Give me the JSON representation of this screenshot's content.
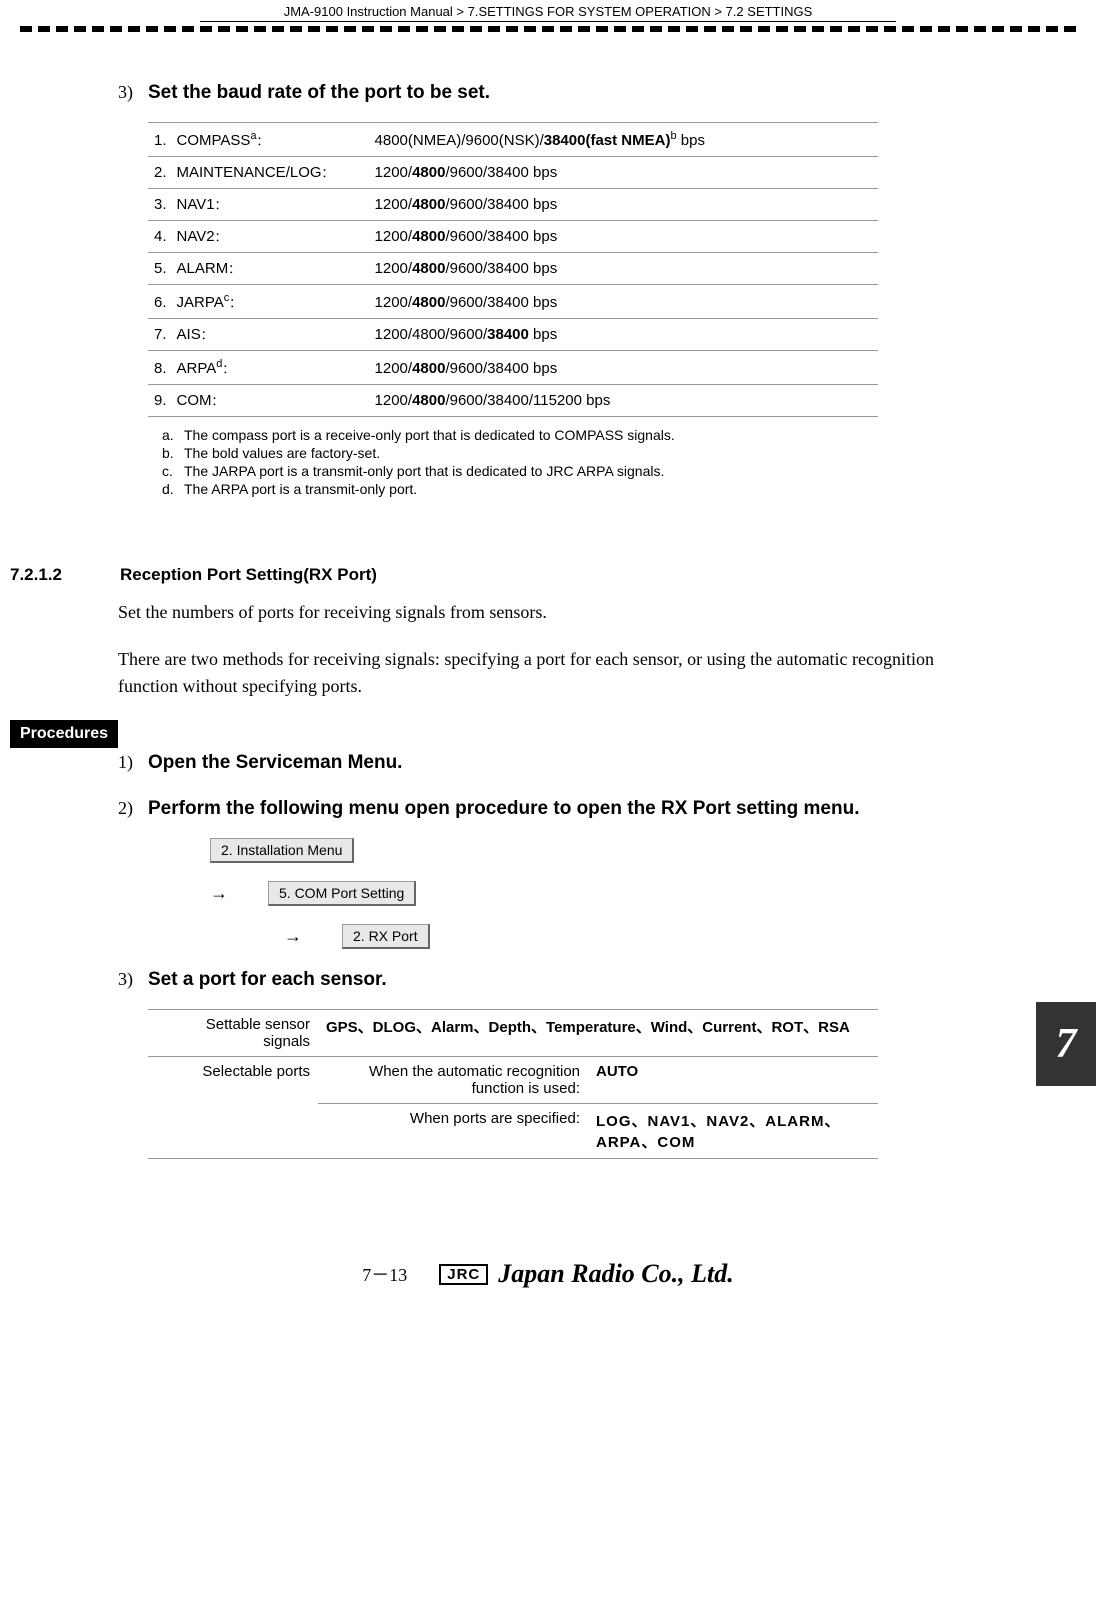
{
  "header": {
    "breadcrumb": "JMA-9100 Instruction Manual > 7.SETTINGS FOR SYSTEM OPERATION > 7.2  SETTINGS"
  },
  "step3": {
    "num": "3)",
    "text": "Set the baud rate of the port to be set."
  },
  "baud_rows": [
    {
      "n": "1.",
      "label": "COMPASS",
      "sup": "a",
      "colon": "：",
      "v_pre": "4800(NMEA)/9600(NSK)/",
      "v_bold": "38400(fast NMEA)",
      "v_sup": "b",
      "v_post": " bps"
    },
    {
      "n": "2.",
      "label": "MAINTENANCE/LOG",
      "sup": "",
      "colon": "：",
      "v_pre": "1200/",
      "v_bold": "4800",
      "v_sup": "",
      "v_post": "/9600/38400 bps"
    },
    {
      "n": "3.",
      "label": "NAV1",
      "sup": "",
      "colon": "：",
      "v_pre": "1200/",
      "v_bold": "4800",
      "v_sup": "",
      "v_post": "/9600/38400 bps"
    },
    {
      "n": "4.",
      "label": "NAV2",
      "sup": "",
      "colon": "：",
      "v_pre": "1200/",
      "v_bold": "4800",
      "v_sup": "",
      "v_post": "/9600/38400 bps"
    },
    {
      "n": "5.",
      "label": "ALARM",
      "sup": "",
      "colon": "：",
      "v_pre": "1200/",
      "v_bold": "4800",
      "v_sup": "",
      "v_post": "/9600/38400 bps"
    },
    {
      "n": "6.",
      "label": "JARPA",
      "sup": "c",
      "colon": "：",
      "v_pre": "1200/",
      "v_bold": "4800",
      "v_sup": "",
      "v_post": "/9600/38400 bps"
    },
    {
      "n": "7.",
      "label": "AIS",
      "sup": "",
      "colon": "：",
      "v_pre": "1200/4800/9600/",
      "v_bold": "38400",
      "v_sup": "",
      "v_post": " bps"
    },
    {
      "n": "8.",
      "label": "ARPA",
      "sup": "d",
      "colon": "：",
      "v_pre": "1200/",
      "v_bold": "4800",
      "v_sup": "",
      "v_post": "/9600/38400 bps"
    },
    {
      "n": "9.",
      "label": "COM",
      "sup": "",
      "colon": "：",
      "v_pre": "1200/",
      "v_bold": "4800",
      "v_sup": "",
      "v_post": "/9600/38400/115200 bps"
    }
  ],
  "footnotes": [
    {
      "l": "a.",
      "t": "The compass port is a receive-only port that is dedicated to COMPASS signals."
    },
    {
      "l": "b.",
      "t": "The bold values are factory-set."
    },
    {
      "l": "c.",
      "t": "The JARPA port is a transmit-only port that is dedicated to JRC ARPA signals."
    },
    {
      "l": "d.",
      "t": "The ARPA port is a transmit-only port."
    }
  ],
  "section": {
    "num": "7.2.1.2",
    "title": "Reception Port Setting(RX Port)",
    "p1": "Set the numbers of ports for receiving signals from sensors.",
    "p2": "There are two methods for receiving signals: specifying a port for each sensor, or using the automatic recognition function without specifying ports."
  },
  "procedures_label": "Procedures",
  "side_tab": "7",
  "proc_step1": {
    "num": "1)",
    "text": "Open the Serviceman Menu."
  },
  "proc_step2": {
    "num": "2)",
    "text": "Perform the following menu open procedure to open the RX Port setting menu."
  },
  "menu": {
    "a": "2. Installation Menu",
    "arrow": "→",
    "b": "5. COM Port Setting",
    "c": "2. RX Port"
  },
  "proc_step3": {
    "num": "3)",
    "text": "Set a port for each sensor."
  },
  "sensor_table": {
    "row1_left": "Settable sensor signals",
    "row1_right": "GPS、DLOG、Alarm、Depth、Temperature、Wind、Current、ROT、RSA",
    "row2_left": "Selectable ports",
    "row2a_mid": "When the automatic recognition function is used:",
    "row2a_right": "AUTO",
    "row2b_mid": "When ports are specified:",
    "row2b_right": "LOG、NAV1、NAV2、ALARM、ARPA、COM"
  },
  "footer": {
    "page": "7－13",
    "jrc": "JRC",
    "company": "Japan Radio Co., Ltd."
  }
}
